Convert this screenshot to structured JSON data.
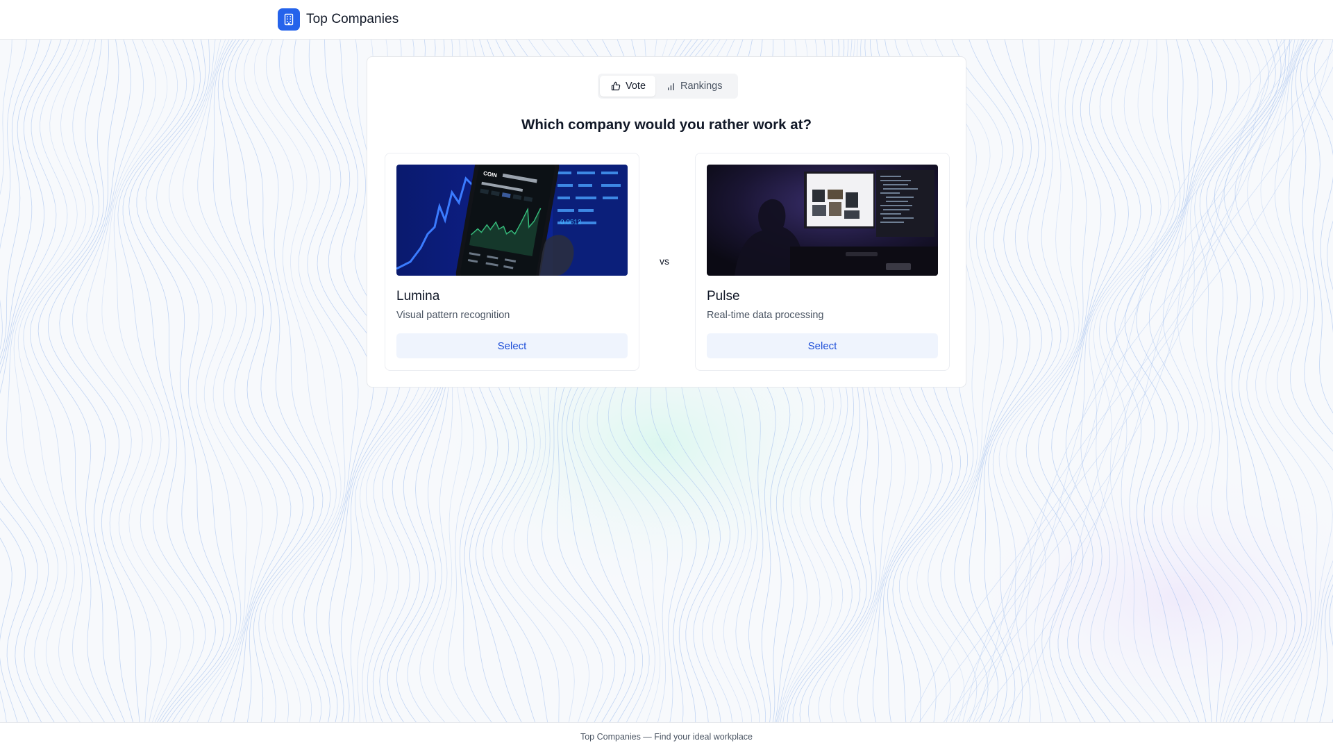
{
  "header": {
    "title": "Top Companies",
    "logo_icon": "building-icon",
    "accent_color": "#2563eb"
  },
  "tabs": [
    {
      "label": "Vote",
      "icon": "thumbs-up-icon",
      "active": true
    },
    {
      "label": "Rankings",
      "icon": "bar-chart-icon",
      "active": false
    }
  ],
  "question": "Which company would you rather work at?",
  "vs_label": "vs",
  "options": [
    {
      "name": "Lumina",
      "description": "Visual pattern recognition",
      "select_label": "Select",
      "image": "phone-stock-chart-photo"
    },
    {
      "name": "Pulse",
      "description": "Real-time data processing",
      "select_label": "Select",
      "image": "dark-room-monitor-photo"
    }
  ],
  "footer": {
    "text": "Top Companies — Find your ideal workplace"
  }
}
